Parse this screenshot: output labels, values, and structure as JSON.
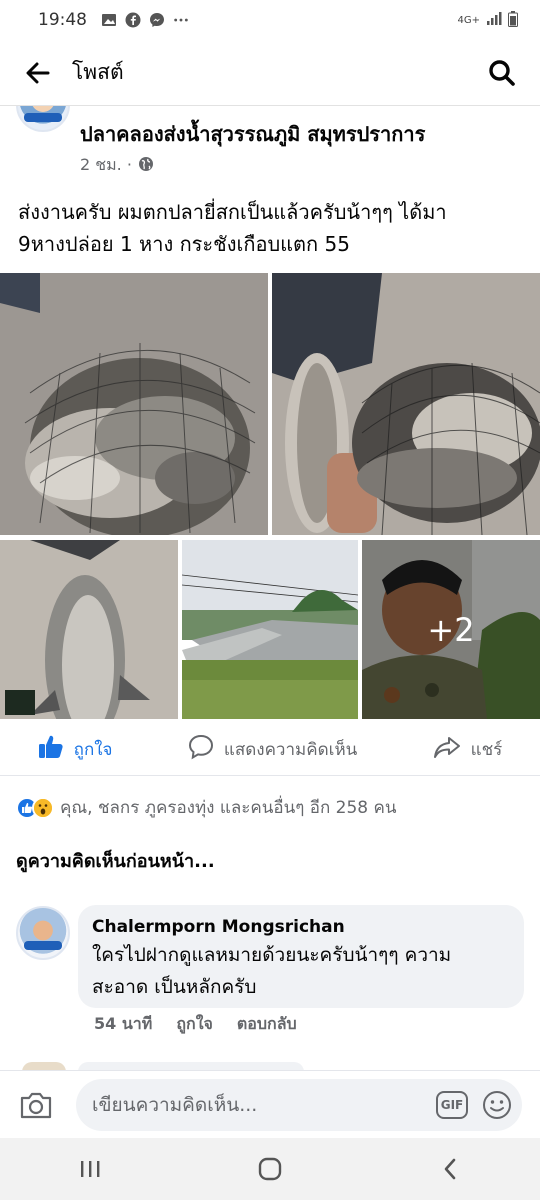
{
  "status_bar": {
    "time": "19:48",
    "network": "4G+"
  },
  "header": {
    "title": "โพสต์"
  },
  "post": {
    "group_name": "ปลาคลองส่งน้ำสุวรรณภูมิ สมุทรปราการ",
    "time": "2 ชม. ·",
    "text_line1": "ส่งงานครับ  ผมตกปลายี่สกเป็นแล้วครับน้าๆๆ ได้มา",
    "text_line2": "9หางปล่อย 1 หาง กระชังเกือบแตก 55",
    "more_photos": "+2"
  },
  "actions": {
    "like": "ถูกใจ",
    "comment": "แสดงความคิดเห็น",
    "share": "แชร์"
  },
  "reactions": {
    "summary": "คุณ, ชลกร ภูครองทุ่ง และคนอื่นๆ อีก 258 คน"
  },
  "comments": {
    "view_previous": "ดูความคิดเห็นก่อนหน้า...",
    "items": [
      {
        "author": "Chalermporn Mongsrichan",
        "line1": "ใครไปฝากดูแลหมายด้วยนะครับน้าๆๆ ความ",
        "line2": "สะอาด เป็นหลักครับ",
        "time": "54 นาที",
        "like": "ถูกใจ",
        "reply": "ตอบกลับ"
      }
    ]
  },
  "composer": {
    "placeholder": "เขียนความคิดเห็น...",
    "gif": "GIF"
  },
  "colors": {
    "accent": "#1b74e4",
    "muted": "#65676b",
    "bubble": "#f0f2f5"
  }
}
